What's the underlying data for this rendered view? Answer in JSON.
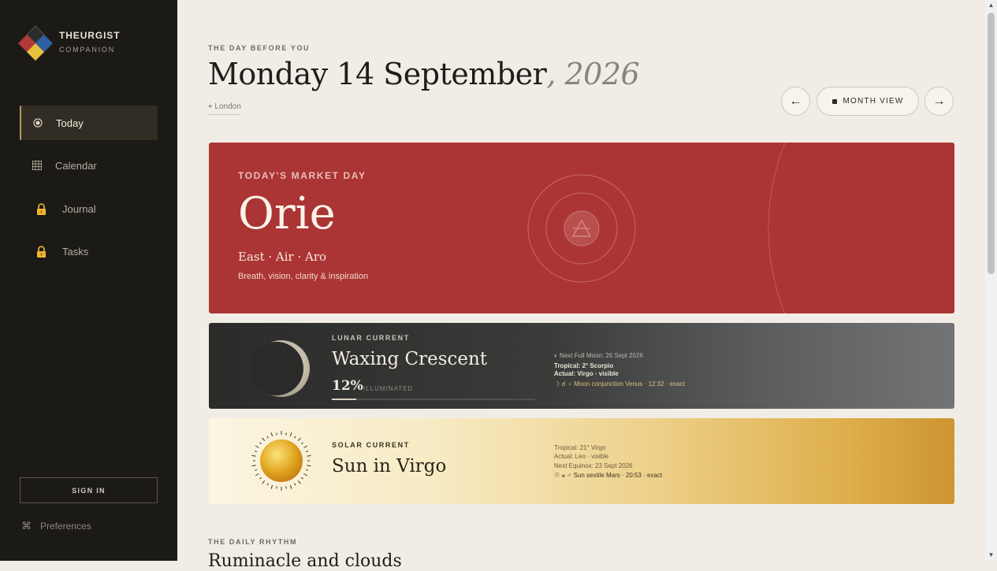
{
  "brand": {
    "name": "THEURGIST",
    "subtitle": "COMPANION"
  },
  "sidebar": {
    "items": [
      {
        "label": "Today",
        "icon": "radio-dot-icon",
        "active": true
      },
      {
        "label": "Calendar",
        "icon": "grid-calendar-icon",
        "active": false
      },
      {
        "label": "Journal",
        "icon": "lock-icon",
        "active": false
      },
      {
        "label": "Tasks",
        "icon": "lock-icon",
        "active": false
      }
    ],
    "signin_label": "SIGN IN",
    "preferences_label": "Preferences"
  },
  "header": {
    "eyebrow": "THE DAY BEFORE YOU",
    "date_main": "Monday 14 September",
    "date_year": ", 2026",
    "location": "⌖ London",
    "prev_label": "←",
    "next_label": "→",
    "month_view_label": "MONTH VIEW"
  },
  "market": {
    "eyebrow": "TODAY'S MARKET DAY",
    "name": "Orie",
    "attributes": "East · Air · Aro",
    "description": "Breath, vision, clarity & inspiration",
    "color": "#ab3535"
  },
  "lunar": {
    "eyebrow": "LUNAR CURRENT",
    "phase": "Waxing Crescent",
    "illumination_pct": "12%",
    "illumination_fraction": 0.12,
    "illuminated_label": "ILLUMINATED",
    "details": [
      "◐   Next Full Moon: 26 Sept 2026",
      "Tropical: 2° Scorpio",
      "Actual: Virgo · visible",
      "☽ ☌ ♀ Moon conjunction Venus · 12:32 · exact"
    ]
  },
  "solar": {
    "eyebrow": "SOLAR CURRENT",
    "title": "Sun in Virgo",
    "details": [
      "Tropical: 21° Virgo",
      "Actual: Leo · visible",
      "Next Equinox: 23 Sept 2026",
      "☉ ⚹ ♂ Sun sextile Mars · 20:53 · exact"
    ]
  },
  "rhythm": {
    "eyebrow": "THE DAILY RHYTHM",
    "title": "Ruminacle and clouds"
  }
}
